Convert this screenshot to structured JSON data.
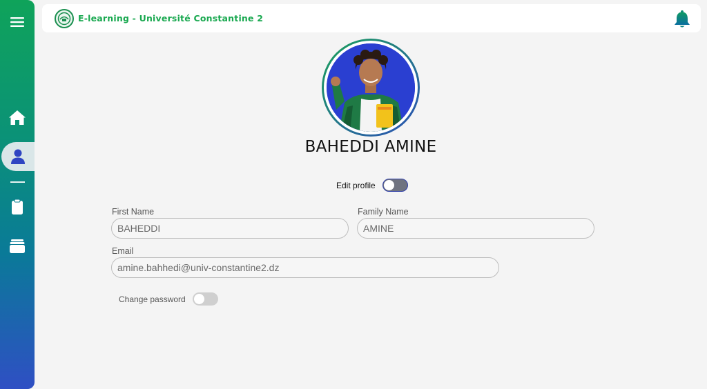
{
  "header": {
    "title": "E-learning - Université Constantine 2",
    "logo_icon": "university-logo",
    "bell_icon": "bell-icon"
  },
  "sidebar": {
    "items": [
      {
        "icon": "menu-icon",
        "active": false
      },
      {
        "icon": "home-icon",
        "active": false
      },
      {
        "icon": "user-icon",
        "active": true
      },
      {
        "icon": "clipboard-icon",
        "active": false
      },
      {
        "icon": "archive-icon",
        "active": false
      }
    ]
  },
  "profile": {
    "name": "BAHEDDI AMINE",
    "edit_label": "Edit profile",
    "edit_on": false
  },
  "form": {
    "first_name_label": "First Name",
    "first_name_value": "BAHEDDI",
    "family_name_label": "Family Name",
    "family_name_value": "AMINE",
    "email_label": "Email",
    "email_value": "amine.bahhedi@univ-constantine2.dz",
    "change_password_label": "Change password",
    "change_password_on": false
  },
  "colors": {
    "brand_green": "#18a84f",
    "bell_teal": "#0a7f8f",
    "sidebar_top": "#0fa35a",
    "sidebar_bottom": "#2f4fc4"
  }
}
